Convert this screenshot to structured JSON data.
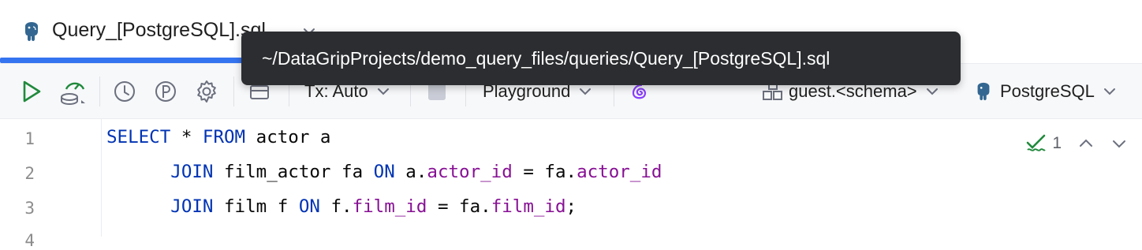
{
  "tab": {
    "label": "Query_[PostgreSQL].sql",
    "icon": "postgresql-elephant-icon"
  },
  "tooltip": {
    "text": "~/DataGripProjects/demo_query_files/queries/Query_[PostgreSQL].sql"
  },
  "toolbar": {
    "transaction_label": "Tx: Auto",
    "playground_label": "Playground",
    "schema_label": "guest.<schema>",
    "datasource_label": "PostgreSQL"
  },
  "editor": {
    "line_numbers": [
      "1",
      "2",
      "3",
      "4"
    ],
    "lines": [
      [
        {
          "t": "SELECT",
          "c": "kw"
        },
        {
          "t": " * ",
          "c": ""
        },
        {
          "t": "FROM",
          "c": "kw"
        },
        {
          "t": " actor a",
          "c": ""
        }
      ],
      [
        {
          "t": "      ",
          "c": ""
        },
        {
          "t": "JOIN",
          "c": "kw"
        },
        {
          "t": " film_actor fa ",
          "c": ""
        },
        {
          "t": "ON",
          "c": "kw"
        },
        {
          "t": " a.",
          "c": ""
        },
        {
          "t": "actor_id",
          "c": "col"
        },
        {
          "t": " = fa.",
          "c": ""
        },
        {
          "t": "actor_id",
          "c": "col"
        }
      ],
      [
        {
          "t": "      ",
          "c": ""
        },
        {
          "t": "JOIN",
          "c": "kw"
        },
        {
          "t": " film f ",
          "c": ""
        },
        {
          "t": "ON",
          "c": "kw"
        },
        {
          "t": " f.",
          "c": ""
        },
        {
          "t": "film_id",
          "c": "col"
        },
        {
          "t": " = fa.",
          "c": ""
        },
        {
          "t": "film_id",
          "c": "col"
        },
        {
          "t": ";",
          "c": ""
        }
      ]
    ],
    "inspection_count": "1"
  },
  "colors": {
    "accent": "#3574f0",
    "keyword": "#0033b3",
    "column": "#871094",
    "run_green": "#208a3c"
  }
}
